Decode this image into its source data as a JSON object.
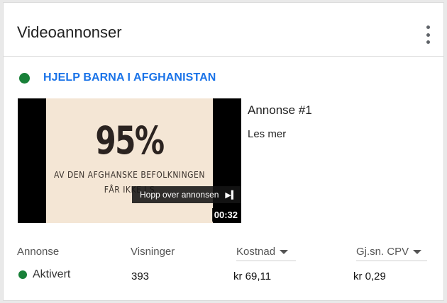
{
  "header": {
    "title": "Videoannonser",
    "menu_icon": "more-vert-icon"
  },
  "campaign": {
    "name": "HJELP BARNA I AFGHANISTAN",
    "status_color": "#188038"
  },
  "video": {
    "big_text": "95%",
    "line1": "AV DEN AFGHANSKE BEFOLKNINGEN",
    "line2": "FÅR IKKE I S",
    "skip_label": "Hopp over annonsen",
    "duration": "00:32"
  },
  "ad": {
    "title": "Annonse #1",
    "link": "Les mer"
  },
  "table": {
    "headers": [
      "Annonse",
      "Visninger",
      "Kostnad",
      "Gj.sn. CPV"
    ],
    "row": {
      "status": "Aktivert",
      "views": "393",
      "cost": "kr 69,11",
      "cpv": "kr 0,29"
    }
  },
  "colors": {
    "accent": "#1a73e8",
    "active": "#188038"
  }
}
